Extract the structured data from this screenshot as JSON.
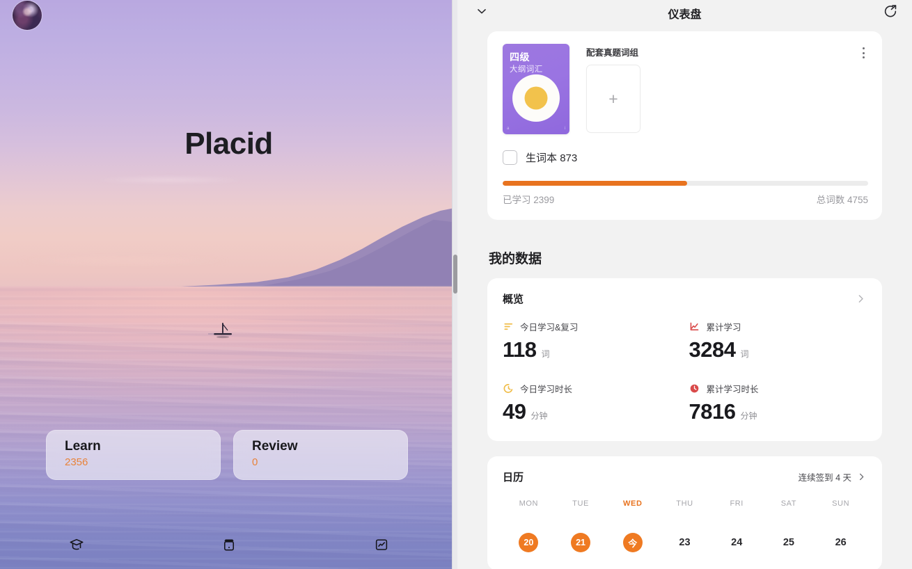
{
  "left": {
    "avatar_name": "user-avatar",
    "app_title": "Placid",
    "learn": {
      "label": "Learn",
      "count": "2356"
    },
    "review": {
      "label": "Review",
      "count": "0"
    },
    "nav": [
      {
        "name": "graduation-cap-icon",
        "label": "Study"
      },
      {
        "name": "archive-box-icon",
        "label": "Library"
      },
      {
        "name": "chart-icon",
        "label": "Statistics"
      }
    ]
  },
  "header": {
    "title": "仪表盘",
    "collapse_icon": "chevron-down-icon",
    "share_icon": "share-refresh-icon"
  },
  "book_card": {
    "cover": {
      "line1": "四级",
      "line2": "大纲词汇",
      "corner_left": "a",
      "corner_right": "i",
      "bg_color": "#9a74e2",
      "yolk_color": "#f2c24c"
    },
    "side_label": "配套真题词组",
    "add_button": "+",
    "menu_icon": "kebab-menu-icon",
    "vocab_book": {
      "label": "生词本",
      "count": "873",
      "checked": false
    },
    "progress": {
      "percent": 50.5,
      "learned_label": "已学习 2399",
      "total_label": "总词数 4755",
      "fill_color": "#e8731f",
      "track_color": "#ececec"
    }
  },
  "my_data": {
    "section_title": "我的数据",
    "overview": {
      "title": "概览",
      "chevron": "chevron-right-icon",
      "stats": [
        {
          "icon": "bar-lines-icon",
          "icon_color": "#f0bd4a",
          "name": "今日学习&复习",
          "value": "118",
          "unit": "词"
        },
        {
          "icon": "trend-line-icon",
          "icon_color": "#d94a4a",
          "name": "累计学习",
          "value": "3284",
          "unit": "词"
        },
        {
          "icon": "moon-clock-icon",
          "icon_color": "#f0bd4a",
          "name": "今日学习时长",
          "value": "49",
          "unit": "分钟"
        },
        {
          "icon": "clock-filled-icon",
          "icon_color": "#d94a4a",
          "name": "累计学习时长",
          "value": "7816",
          "unit": "分钟"
        }
      ]
    },
    "calendar": {
      "title": "日历",
      "streak_label": "连续签到 4 天",
      "chevron": "chevron-right-icon",
      "weekdays": [
        "MON",
        "TUE",
        "WED",
        "THU",
        "FRI",
        "SAT",
        "SUN"
      ],
      "days": [
        {
          "text": "20",
          "state": "marked"
        },
        {
          "text": "21",
          "state": "marked"
        },
        {
          "text": "今",
          "state": "today"
        },
        {
          "text": "23",
          "state": "plain"
        },
        {
          "text": "24",
          "state": "plain"
        },
        {
          "text": "25",
          "state": "plain"
        },
        {
          "text": "26",
          "state": "plain"
        }
      ],
      "today_index": 2,
      "accent_color": "#ef7a22"
    }
  }
}
